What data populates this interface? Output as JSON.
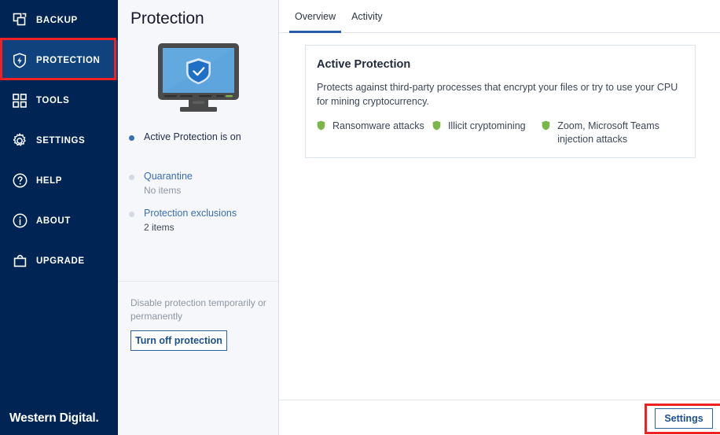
{
  "sidebar": {
    "items": [
      {
        "label": "BACKUP",
        "icon": "backup-copies-icon",
        "active": false
      },
      {
        "label": "PROTECTION",
        "icon": "shield-bolt-icon",
        "active": true
      },
      {
        "label": "TOOLS",
        "icon": "grid-squares-icon",
        "active": false
      },
      {
        "label": "SETTINGS",
        "icon": "gear-icon",
        "active": false
      },
      {
        "label": "HELP",
        "icon": "question-circle-icon",
        "active": false
      },
      {
        "label": "ABOUT",
        "icon": "info-circle-icon",
        "active": false
      },
      {
        "label": "UPGRADE",
        "icon": "bag-icon",
        "active": false
      }
    ],
    "brand": "Western Digital",
    "brand_dot": "."
  },
  "middle": {
    "title": "Protection",
    "illustration_name": "monitor-shield-illustration",
    "status": [
      {
        "label": "Active Protection is on",
        "sub": "",
        "link": false,
        "on": true
      },
      {
        "label": "Quarantine",
        "sub": "No items",
        "link": true,
        "on": false
      },
      {
        "label": "Protection exclusions",
        "sub": "2 items",
        "link": true,
        "on": false
      }
    ],
    "disable_text": "Disable protection temporarily or permanently",
    "turn_off_label": "Turn off protection"
  },
  "main": {
    "tabs": [
      {
        "label": "Overview",
        "active": true
      },
      {
        "label": "Activity",
        "active": false
      }
    ],
    "card": {
      "title": "Active Protection",
      "description": "Protects against third-party processes that encrypt your files or try to use your CPU for mining cryptocurrency.",
      "features": [
        {
          "label": "Ransomware attacks",
          "icon": "shield-icon"
        },
        {
          "label": "Illicit cryptomining",
          "icon": "shield-icon"
        },
        {
          "label": "Zoom, Microsoft Teams injection attacks",
          "icon": "shield-icon"
        }
      ]
    },
    "settings_label": "Settings"
  },
  "annotations": [
    {
      "name": "highlight-protection",
      "color": "#ee2222"
    },
    {
      "name": "highlight-settings",
      "color": "#ee2222"
    }
  ],
  "colors": {
    "sidebar_bg": "#002554",
    "sidebar_active_bg": "#10437e",
    "accent_blue": "#1d4f91",
    "tab_underline": "#2a5caa",
    "feature_shield_green": "#7ab648",
    "panel_bg": "#f5f7fa",
    "annotation_red": "#ee2222"
  }
}
